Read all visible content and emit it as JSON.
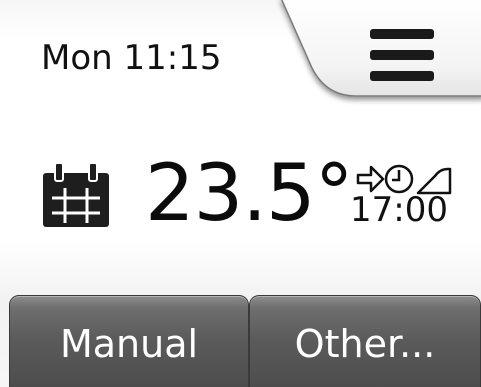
{
  "status": {
    "datetime": "Mon 11:15"
  },
  "menu": {
    "icon": "hamburger-menu-icon"
  },
  "thermostat": {
    "mode_icon": "calendar-schedule-icon",
    "temperature": "23.5°",
    "next_change_icons": [
      "arrow-right-icon",
      "clock-icon",
      "ramp-icon"
    ],
    "next_change_time": "17:00"
  },
  "buttons": {
    "manual": "Manual",
    "other": "Other..."
  },
  "colors": {
    "button_gradient_top": "#8e8e8e",
    "button_gradient_bottom": "#4b4b4b",
    "text": "#111111"
  }
}
